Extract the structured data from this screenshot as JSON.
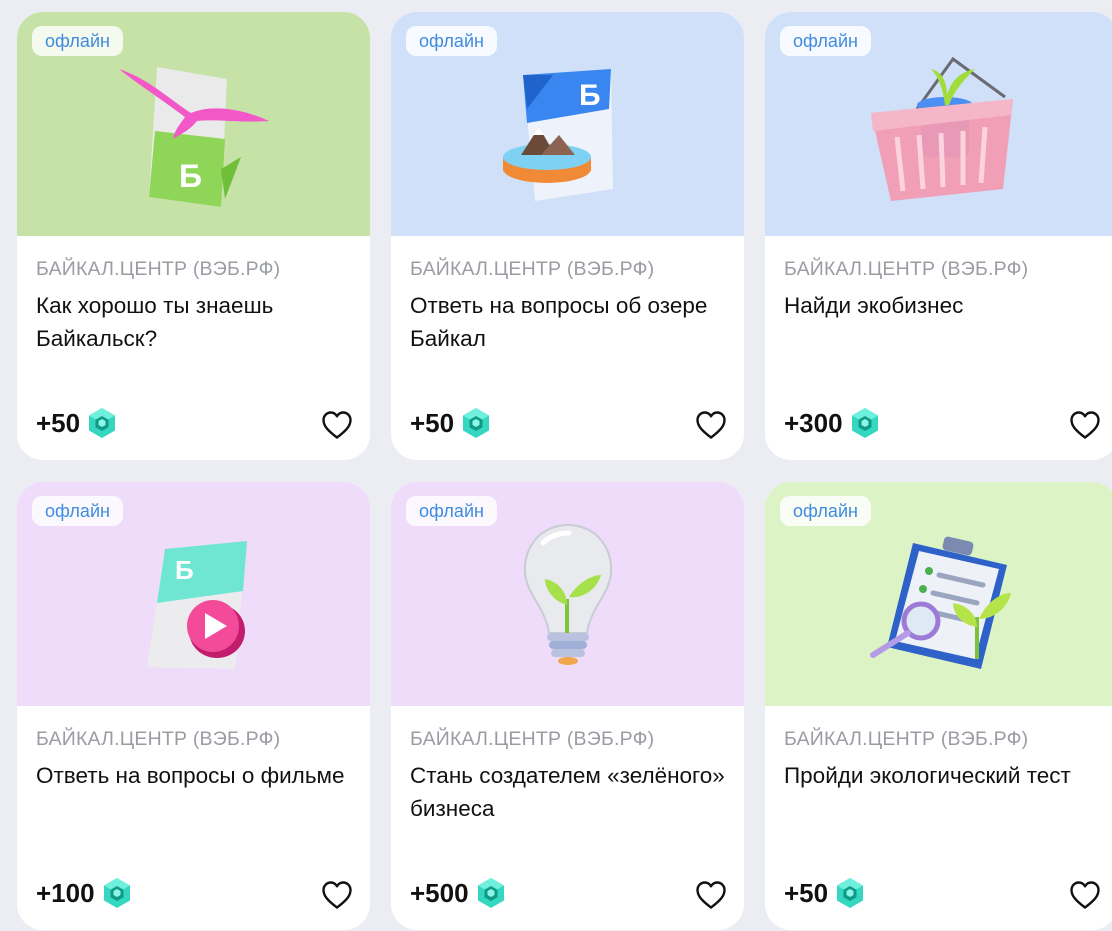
{
  "colors": {
    "page_bg": "#ecedf3",
    "badge_text": "#3f8be0",
    "org_text": "#9a9ca3",
    "coin_accent": "#35d7c0"
  },
  "cards": [
    {
      "cover_color": "#c7e2a6",
      "badge": "офлайн",
      "illustration": "document-with-pink-seagull",
      "org": "БАЙКАЛ.ЦЕНТР (ВЭБ.РФ)",
      "title": "Как хорошо ты знаешь Байкальск?",
      "points": "+50",
      "coin_icon": "hexagon-coin-icon",
      "favorite_icon": "heart-outline-icon"
    },
    {
      "cover_color": "#cfe0f8",
      "badge": "офлайн",
      "illustration": "document-with-mountains",
      "org": "БАЙКАЛ.ЦЕНТР (ВЭБ.РФ)",
      "title": "Ответь на вопросы об озере Байкал",
      "points": "+50",
      "coin_icon": "hexagon-coin-icon",
      "favorite_icon": "heart-outline-icon"
    },
    {
      "cover_color": "#cfe0f8",
      "badge": "офлайн",
      "illustration": "basket-with-plant-pot",
      "org": "БАЙКАЛ.ЦЕНТР (ВЭБ.РФ)",
      "title": "Найди экобизнес",
      "points": "+300",
      "coin_icon": "hexagon-coin-icon",
      "favorite_icon": "heart-outline-icon"
    },
    {
      "cover_color": "#efdcfa",
      "badge": "офлайн",
      "illustration": "document-with-play-button",
      "org": "БАЙКАЛ.ЦЕНТР (ВЭБ.РФ)",
      "title": "Ответь на вопросы о фильме",
      "points": "+100",
      "coin_icon": "hexagon-coin-icon",
      "favorite_icon": "heart-outline-icon"
    },
    {
      "cover_color": "#efdcfa",
      "badge": "офлайн",
      "illustration": "lightbulb-with-sprout",
      "org": "БАЙКАЛ.ЦЕНТР (ВЭБ.РФ)",
      "title": "Стань создателем «зелёного» бизнеса",
      "points": "+500",
      "coin_icon": "hexagon-coin-icon",
      "favorite_icon": "heart-outline-icon"
    },
    {
      "cover_color": "#dcf3c6",
      "badge": "офлайн",
      "illustration": "clipboard-with-magnifier-and-sprout",
      "org": "БАЙКАЛ.ЦЕНТР (ВЭБ.РФ)",
      "title": "Пройди экологический тест",
      "points": "+50",
      "coin_icon": "hexagon-coin-icon",
      "favorite_icon": "heart-outline-icon"
    }
  ]
}
